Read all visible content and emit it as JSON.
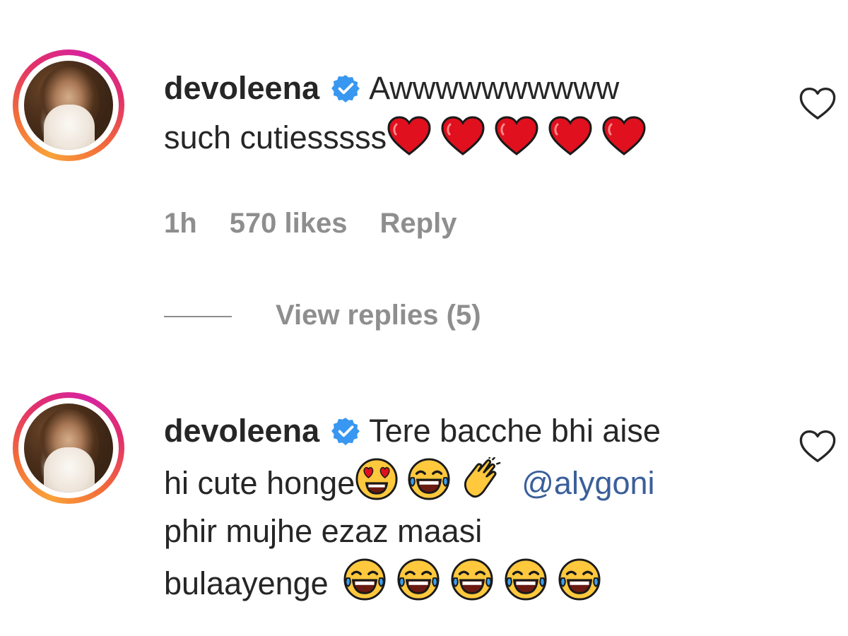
{
  "comments": [
    {
      "username": "devoleena",
      "line1": "Awwwwwwwwww",
      "line2": "such cutiesssss",
      "line2_emojis": [
        "red-heart",
        "red-heart",
        "red-heart",
        "red-heart",
        "red-heart"
      ],
      "time": "1h",
      "likes": "570 likes",
      "reply_label": "Reply",
      "view_replies": "View replies (5)"
    },
    {
      "username": "devoleena",
      "line1": "Tere bacche bhi aise",
      "line2": "hi cute honge",
      "line2_emojis": [
        "heart-eyes-face",
        "tears-of-joy-face",
        "clapping-hands"
      ],
      "mention": "@alygoni",
      "line3": "phir mujhe ezaz maasi",
      "line4": "bulaayenge",
      "line4_emojis": [
        "tears-of-joy-face",
        "tears-of-joy-face",
        "tears-of-joy-face",
        "tears-of-joy-face",
        "tears-of-joy-face"
      ]
    }
  ],
  "icons": {
    "verified": "verified-badge-icon",
    "like": "heart-outline-icon"
  },
  "colors": {
    "text": "#262626",
    "muted": "#8e8e8e",
    "mention": "#3a5f9a",
    "verified": "#3897f0",
    "heart_emoji": "#e0101e"
  }
}
